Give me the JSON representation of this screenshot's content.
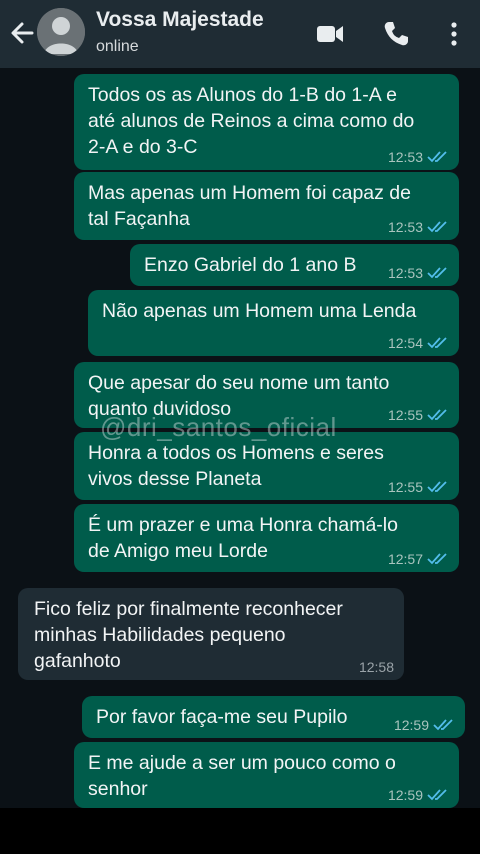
{
  "header": {
    "contact_name": "Vossa Majestade",
    "status": "online",
    "icons": [
      "back-arrow-icon",
      "avatar",
      "video-call-icon",
      "phone-icon",
      "more-options-icon"
    ]
  },
  "colors": {
    "header_bg": "#1f2c34",
    "chat_bg": "#0b1116",
    "outgoing_bubble": "#005c4b",
    "incoming_bubble": "#1f2c34",
    "read_tick": "#53bdeb"
  },
  "messages": [
    {
      "direction": "out",
      "text": "Todos os as Alunos do 1-B do 1-A e\naté alunos de Reinos a cima como do\n2-A e do 3-C",
      "time": "12:53",
      "read": true
    },
    {
      "direction": "out",
      "text": "Mas apenas um Homem foi capaz de\ntal Façanha",
      "time": "12:53",
      "read": true
    },
    {
      "direction": "out",
      "text": "Enzo Gabriel do 1 ano B",
      "time": "12:53",
      "read": true
    },
    {
      "direction": "out",
      "text": "Não apenas um Homem uma Lenda",
      "time": "12:54",
      "read": true
    },
    {
      "direction": "out",
      "text": "Que apesar do seu nome um tanto\nquanto duvidoso",
      "time": "12:55",
      "read": true
    },
    {
      "direction": "out",
      "text": "Honra a todos os Homens e seres\nvivos desse Planeta",
      "time": "12:55",
      "read": true
    },
    {
      "direction": "out",
      "text": "É um prazer e uma Honra chamá-lo\nde Amigo meu Lorde",
      "time": "12:57",
      "read": true
    },
    {
      "direction": "in",
      "text": "Fico feliz por finalmente reconhecer\nminhas Habilidades pequeno\ngafanhoto",
      "time": "12:58",
      "read": false
    },
    {
      "direction": "out",
      "text": "Por favor faça-me seu Pupilo",
      "time": "12:59",
      "read": true
    },
    {
      "direction": "out",
      "text": "E me ajude a ser um pouco como o\nsenhor",
      "time": "12:59",
      "read": true
    }
  ],
  "watermark": "@dri_santos_oficial"
}
